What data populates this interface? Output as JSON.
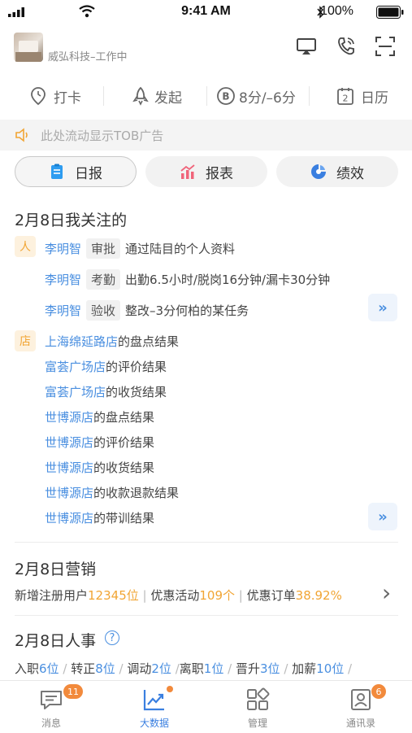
{
  "status_bar": {
    "time": "9:41 AM",
    "battery": "100%"
  },
  "header": {
    "company": "威弘科技–工作中"
  },
  "quick_actions": [
    {
      "label": "打卡",
      "icon": "location-pin-icon"
    },
    {
      "label": "发起",
      "icon": "rocket-icon"
    },
    {
      "label": "8分/–6分",
      "icon": "coin-icon"
    },
    {
      "label": "日历",
      "icon": "calendar-icon",
      "icon_text": "2"
    }
  ],
  "ad": {
    "text": "此处流动显示TOB广告"
  },
  "tabs": [
    {
      "label": "日报",
      "icon": "daily-report-icon"
    },
    {
      "label": "报表",
      "icon": "bar-chart-icon"
    },
    {
      "label": "绩效",
      "icon": "performance-icon"
    }
  ],
  "focus": {
    "title": "2月8日我关注的",
    "person_tag": "人",
    "store_tag": "店",
    "person_items": [
      {
        "name": "李明智",
        "kind": "审批",
        "text": "通过陆目的个人资料"
      },
      {
        "name": "李明智",
        "kind": "考勤",
        "text": "出勤6.5小时/脱岗16分钟/漏卡30分钟"
      },
      {
        "name": "李明智",
        "kind": "验收",
        "text": "整改–3分何柏的某任务"
      }
    ],
    "store_items": [
      {
        "store": "上海绵延路店",
        "text": "的盘点结果"
      },
      {
        "store": "富荟广场店",
        "text": "的评价结果"
      },
      {
        "store": "富荟广场店",
        "text": "的收货结果"
      },
      {
        "store": "世博源店",
        "text": "的盘点结果"
      },
      {
        "store": "世博源店",
        "text": "的评价结果"
      },
      {
        "store": "世博源店",
        "text": "的收货结果"
      },
      {
        "store": "世博源店",
        "text": "的收款退款结果"
      },
      {
        "store": "世博源店",
        "text": "的带训结果"
      }
    ],
    "more_label": "»"
  },
  "marketing": {
    "title": "2月8日营销",
    "new_users_label": "新增注册用户",
    "new_users_value": "12345位",
    "promo_label": "优惠活动",
    "promo_value": "109个",
    "order_label": "优惠订单",
    "order_value": "38.92%",
    "sep": "|",
    "arrow": "›"
  },
  "hr": {
    "title": "2月8日人事",
    "help": "?",
    "items": [
      {
        "label": "入职",
        "value": "6位"
      },
      {
        "label": "转正",
        "value": "8位"
      },
      {
        "label": "调动",
        "value": "2位"
      },
      {
        "label": "离职",
        "value": "1位"
      },
      {
        "label": "晋升",
        "value": "3位"
      },
      {
        "label": "加薪",
        "value": "10位"
      }
    ],
    "sep": "/"
  },
  "tabbar": [
    {
      "label": "消息",
      "badge": "11"
    },
    {
      "label": "大数据",
      "badge": ""
    },
    {
      "label": "管理",
      "badge": ""
    },
    {
      "label": "通讯录",
      "badge": "6"
    }
  ],
  "colors": {
    "accent_blue": "#4a8fe0",
    "accent_orange": "#f1a534",
    "badge_orange": "#f28a3c"
  }
}
